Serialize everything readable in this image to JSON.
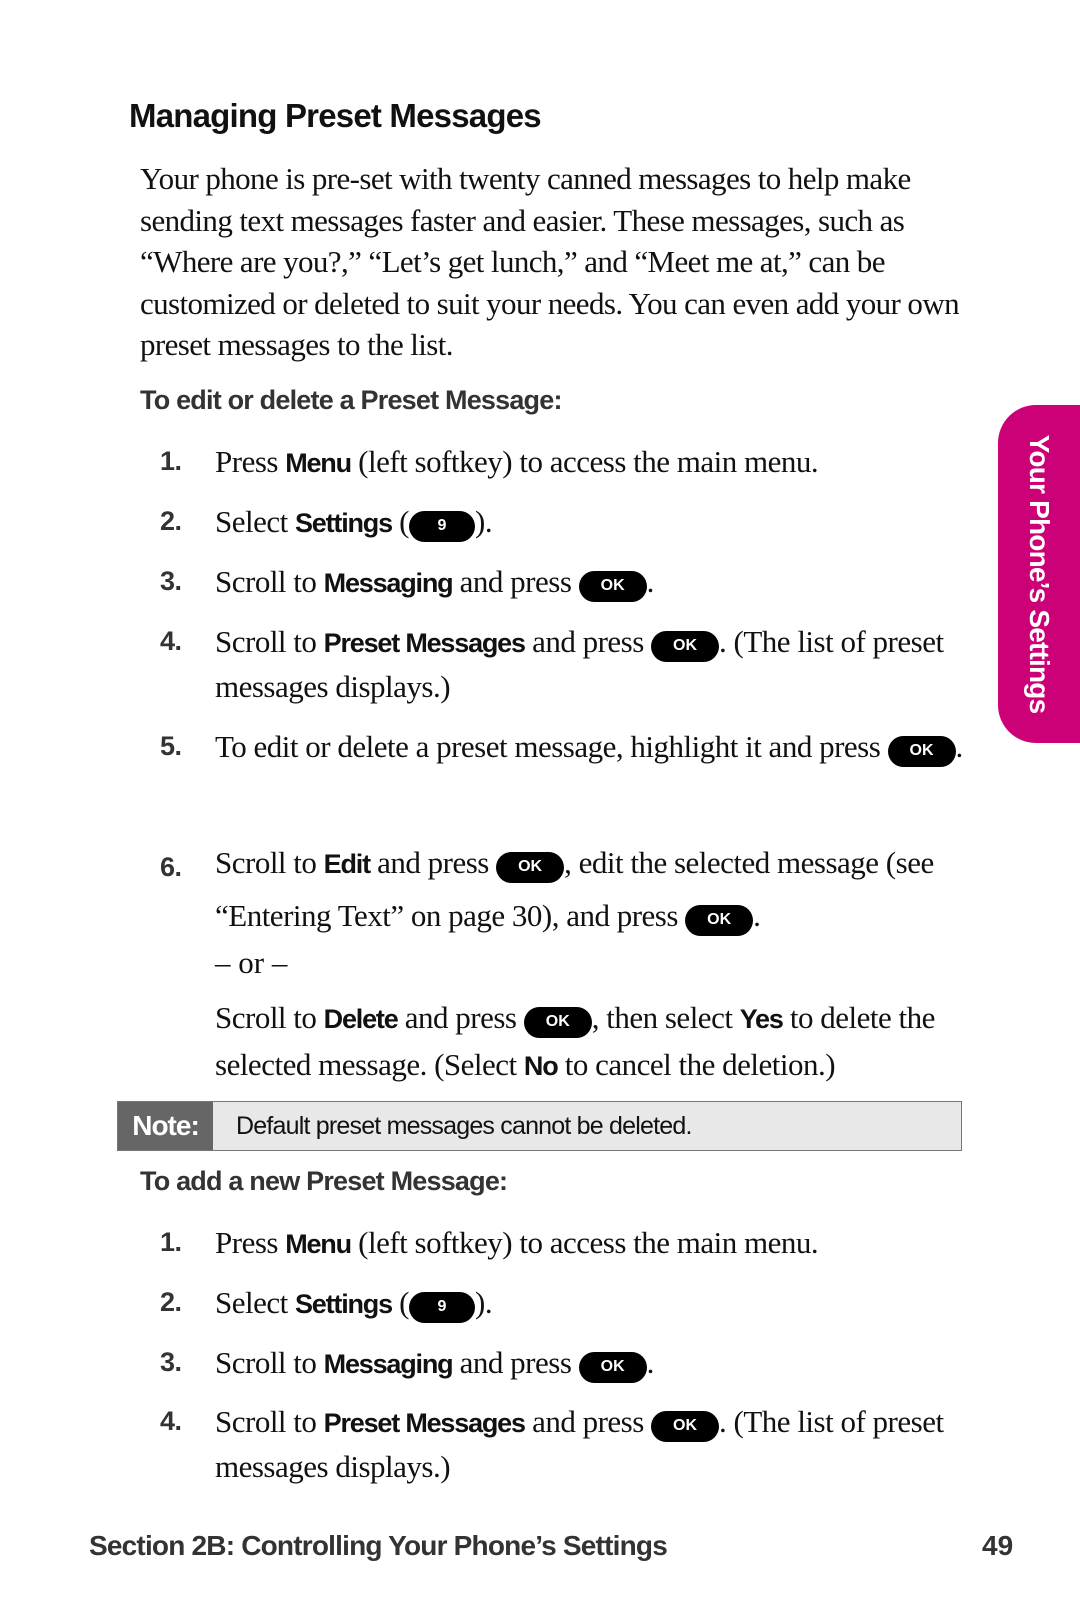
{
  "page": {
    "title": "Managing Preset Messages",
    "intro": "Your phone is pre-set with twenty canned messages to help make sending text messages faster and easier. These messages, such as “Where are you?,” “Let’s get lunch,” and “Meet me at,” can be customized or deleted to suit your needs. You can even add your own preset messages to the list.",
    "side_tab": "Your Phone’s Settings",
    "footer": {
      "section": "Section 2B: Controlling Your Phone’s Settings",
      "page_number": "49"
    }
  },
  "keys": {
    "ok": "OK",
    "nine": "9"
  },
  "edit_section": {
    "heading": "To edit or delete a Preset Message:",
    "steps": [
      {
        "num": "1.",
        "pre": "Press ",
        "bold": "Menu",
        "post": " (left softkey) to access the main menu."
      },
      {
        "num": "2.",
        "pre": "Select ",
        "bold": "Settings",
        "mid": " (",
        "post": ")."
      },
      {
        "num": "3.",
        "pre": "Scroll to ",
        "bold": "Messaging",
        "mid": " and press ",
        "post": "."
      },
      {
        "num": "4.",
        "pre": "Scroll to ",
        "bold": "Preset Messages",
        "mid": " and press ",
        "post": ". (The list of preset messages displays.)"
      },
      {
        "num": "5.",
        "pre": "To edit or delete a preset message, highlight it and press ",
        "post": "."
      },
      {
        "num": "6.",
        "pre": "Scroll to ",
        "bold": "Edit",
        "mid": " and press ",
        "mid2": ", edit the selected message (see “Entering Text” on page 30), and press ",
        "post": "."
      }
    ],
    "or_text": "– or –",
    "alt": {
      "pre": "Scroll to ",
      "bold": "Delete",
      "mid": " and press ",
      "mid2": ", then select ",
      "bold2": "Yes",
      "mid3": " to delete the selected message. (Select ",
      "bold3": "No",
      "post": " to cancel the deletion.)"
    }
  },
  "note": {
    "label": "Note:",
    "text": "Default preset messages cannot be deleted."
  },
  "add_section": {
    "heading": "To add a new Preset Message:",
    "steps": [
      {
        "num": "1.",
        "pre": "Press ",
        "bold": "Menu",
        "post": " (left softkey) to access the main menu."
      },
      {
        "num": "2.",
        "pre": "Select ",
        "bold": "Settings",
        "mid": " (",
        "post": ")."
      },
      {
        "num": "3.",
        "pre": "Scroll to ",
        "bold": "Messaging",
        "mid": " and press ",
        "post": "."
      },
      {
        "num": "4.",
        "pre": "Scroll to ",
        "bold": "Preset Messages",
        "mid": " and press ",
        "post": ". (The list of preset messages displays.)"
      }
    ]
  }
}
